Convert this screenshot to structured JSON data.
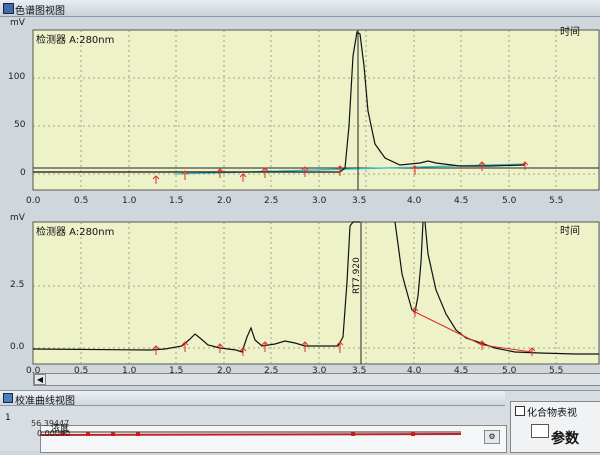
{
  "window": {
    "title": "色谱图视图"
  },
  "upper_chart": {
    "unit": "mV",
    "detector": "检测器 A:280nm",
    "time_label": "时间",
    "y_ticks": [
      "100",
      "50",
      "0"
    ],
    "x_ticks": [
      "0.0",
      "0.5",
      "1.0",
      "1.5",
      "2.0",
      "2.5",
      "3.0",
      "3.5",
      "4.0",
      "4.5",
      "5.0",
      "5.5"
    ]
  },
  "lower_chart": {
    "unit": "mV",
    "detector": "检测器 A:280nm",
    "time_label": "时间",
    "rt_label": "RT7.920",
    "y_ticks": [
      "2.5",
      "0.0"
    ],
    "x_ticks": [
      "0.0",
      "0.5",
      "1.0",
      "1.5",
      "2.0",
      "2.5",
      "3.0",
      "3.5",
      "4.0",
      "4.5",
      "5.0",
      "5.5"
    ]
  },
  "calibration_panel": {
    "title": "校准曲线视图",
    "concentration_label": "浓度",
    "value_top": "56.39447",
    "value": "0.00000",
    "row_index": "1"
  },
  "compound_panel": {
    "title": "化合物表视",
    "tab_label": "参数"
  },
  "colors": {
    "plot_bg": "#eef2c8",
    "trace": "#111111",
    "baseline": "#2fb9c9",
    "markers": "#e0302a"
  }
}
